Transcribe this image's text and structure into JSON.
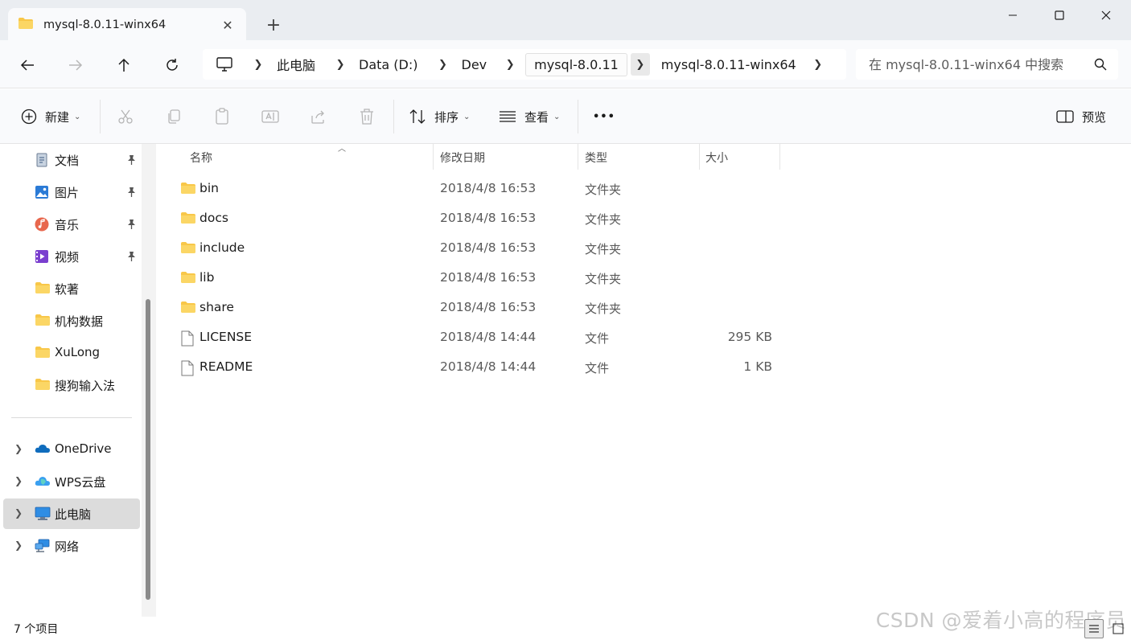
{
  "window": {
    "tab_title": "mysql-8.0.11-winx64",
    "tab_close": "✕",
    "new_tab": "+"
  },
  "address": {
    "crumbs": [
      "此电脑",
      "Data (D:)",
      "Dev",
      "mysql-8.0.11",
      "mysql-8.0.11-winx64"
    ]
  },
  "search": {
    "placeholder": "在 mysql-8.0.11-winx64 中搜索"
  },
  "commands": {
    "new_label": "新建",
    "sort_label": "排序",
    "view_label": "查看",
    "more_label": "•••",
    "preview_label": "预览"
  },
  "sidebar": {
    "items": [
      {
        "label": "文档",
        "icon": "documents-icon",
        "pinned": true
      },
      {
        "label": "图片",
        "icon": "pictures-icon",
        "pinned": true
      },
      {
        "label": "音乐",
        "icon": "music-icon",
        "pinned": true
      },
      {
        "label": "视频",
        "icon": "videos-icon",
        "pinned": true
      },
      {
        "label": "软著",
        "icon": "folder-icon",
        "pinned": false
      },
      {
        "label": "机构数据",
        "icon": "folder-icon",
        "pinned": false
      },
      {
        "label": "XuLong",
        "icon": "folder-icon",
        "pinned": false
      },
      {
        "label": "搜狗输入法",
        "icon": "folder-icon",
        "pinned": false
      }
    ],
    "locations": [
      {
        "label": "OneDrive",
        "icon": "onedrive-icon"
      },
      {
        "label": "WPS云盘",
        "icon": "wps-cloud-icon"
      },
      {
        "label": "此电脑",
        "icon": "this-pc-icon",
        "active": true
      },
      {
        "label": "网络",
        "icon": "network-icon"
      }
    ]
  },
  "columns": {
    "name": "名称",
    "modified": "修改日期",
    "type": "类型",
    "size": "大小"
  },
  "files": [
    {
      "name": "bin",
      "modified": "2018/4/8 16:53",
      "type": "文件夹",
      "size": "",
      "kind": "folder"
    },
    {
      "name": "docs",
      "modified": "2018/4/8 16:53",
      "type": "文件夹",
      "size": "",
      "kind": "folder"
    },
    {
      "name": "include",
      "modified": "2018/4/8 16:53",
      "type": "文件夹",
      "size": "",
      "kind": "folder"
    },
    {
      "name": "lib",
      "modified": "2018/4/8 16:53",
      "type": "文件夹",
      "size": "",
      "kind": "folder"
    },
    {
      "name": "share",
      "modified": "2018/4/8 16:53",
      "type": "文件夹",
      "size": "",
      "kind": "folder"
    },
    {
      "name": "LICENSE",
      "modified": "2018/4/8 14:44",
      "type": "文件",
      "size": "295 KB",
      "kind": "file"
    },
    {
      "name": "README",
      "modified": "2018/4/8 14:44",
      "type": "文件",
      "size": "1 KB",
      "kind": "file"
    }
  ],
  "status": {
    "item_count": "7 个项目"
  },
  "watermark": "CSDN @爱着小高的程序员",
  "colors": {
    "folder": "#f8c749",
    "chrome_bg": "#eaedf1",
    "accent": "#0067c0"
  }
}
